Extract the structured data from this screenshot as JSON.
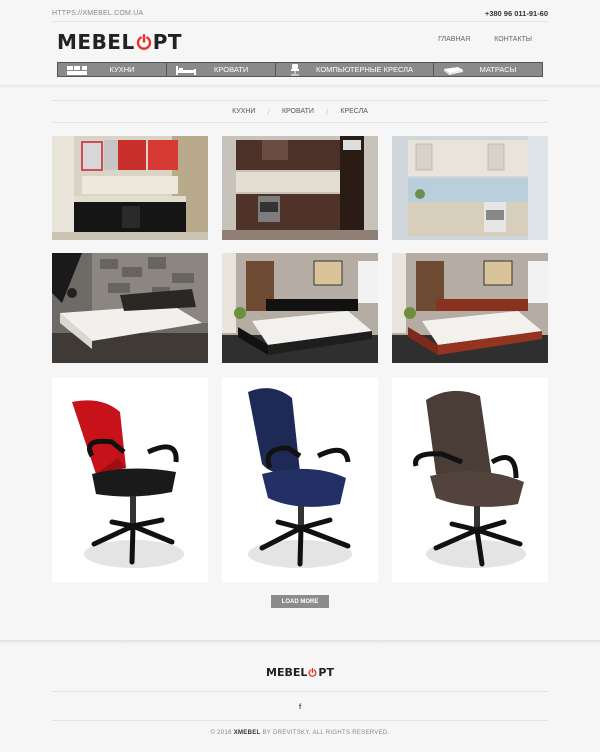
{
  "topbar": {
    "url": "HTTPS://XMEBEL.COM.UA",
    "phone": "+380 96 011-91-60"
  },
  "logo": {
    "left": "MEBEL",
    "right": "PT"
  },
  "main_nav": [
    {
      "label": "ГЛАВНАЯ"
    },
    {
      "label": "КОНТАКТЫ"
    }
  ],
  "categories": [
    {
      "label": "КУХНИ",
      "icon": "kitchen-icon"
    },
    {
      "label": "КРОВАТИ",
      "icon": "bed-icon"
    },
    {
      "label": "КОМПЬЮТЕРНЫЕ КРЕСЛА",
      "icon": "chair-icon"
    },
    {
      "label": "МАТРАСЫ",
      "icon": "mattress-icon"
    }
  ],
  "filters": [
    "КУХНИ",
    "КРОВАТИ",
    "КРЕСЛА"
  ],
  "gallery": [
    {
      "kind": "kitchen",
      "variant": "red"
    },
    {
      "kind": "kitchen",
      "variant": "brown"
    },
    {
      "kind": "kitchen",
      "variant": "white"
    },
    {
      "kind": "bed",
      "variant": "stone"
    },
    {
      "kind": "bed",
      "variant": "dark"
    },
    {
      "kind": "bed",
      "variant": "red"
    },
    {
      "kind": "chair",
      "variant": "red-mesh"
    },
    {
      "kind": "chair",
      "variant": "blue"
    },
    {
      "kind": "chair",
      "variant": "brown"
    }
  ],
  "load_more": "LOAD MORE",
  "footer": {
    "logo_left": "MEBEL",
    "logo_right": "PT",
    "social": "f",
    "copy_prefix": "© 2016",
    "copy_brand": "XMEBEL",
    "copy_suffix": "BY DREVITSKY. ALL RIGHTS RESERVED."
  },
  "colors": {
    "accent": "#e8332a",
    "nav_bg": "#8a8a8a",
    "page_bg": "#f6f6f6"
  }
}
